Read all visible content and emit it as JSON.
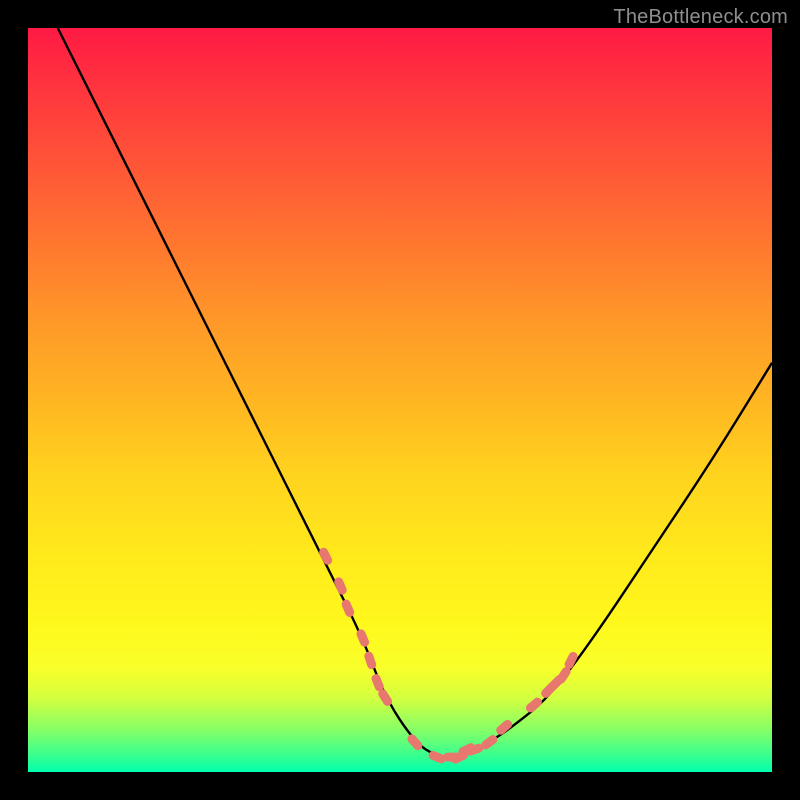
{
  "watermark": {
    "text": "TheBottleneck.com"
  },
  "chart_data": {
    "type": "line",
    "title": "",
    "xlabel": "",
    "ylabel": "",
    "xlim": [
      0,
      100
    ],
    "ylim": [
      0,
      100
    ],
    "series": [
      {
        "name": "bottleneck-curve",
        "x": [
          4,
          10,
          16,
          22,
          28,
          34,
          40,
          45,
          48,
          52,
          55,
          58,
          60,
          62,
          65,
          70,
          76,
          84,
          92,
          100
        ],
        "values": [
          100,
          88,
          76,
          64,
          52,
          40,
          28,
          18,
          10,
          4,
          2,
          2,
          3,
          4,
          6,
          10,
          18,
          30,
          42,
          55
        ]
      }
    ],
    "highlights": {
      "name": "salmon-dots",
      "x": [
        40,
        42,
        43,
        45,
        46,
        47,
        48,
        52,
        55,
        57,
        58,
        59,
        60,
        62,
        64,
        68,
        70,
        71,
        72,
        73
      ],
      "values": [
        29,
        25,
        22,
        18,
        15,
        12,
        10,
        4,
        2,
        2,
        2,
        3,
        3,
        4,
        6,
        9,
        11,
        12,
        13,
        15
      ]
    },
    "background_gradient": {
      "top": "#ff1a44",
      "mid": "#ffd31e",
      "bottom": "#00ffad"
    }
  }
}
